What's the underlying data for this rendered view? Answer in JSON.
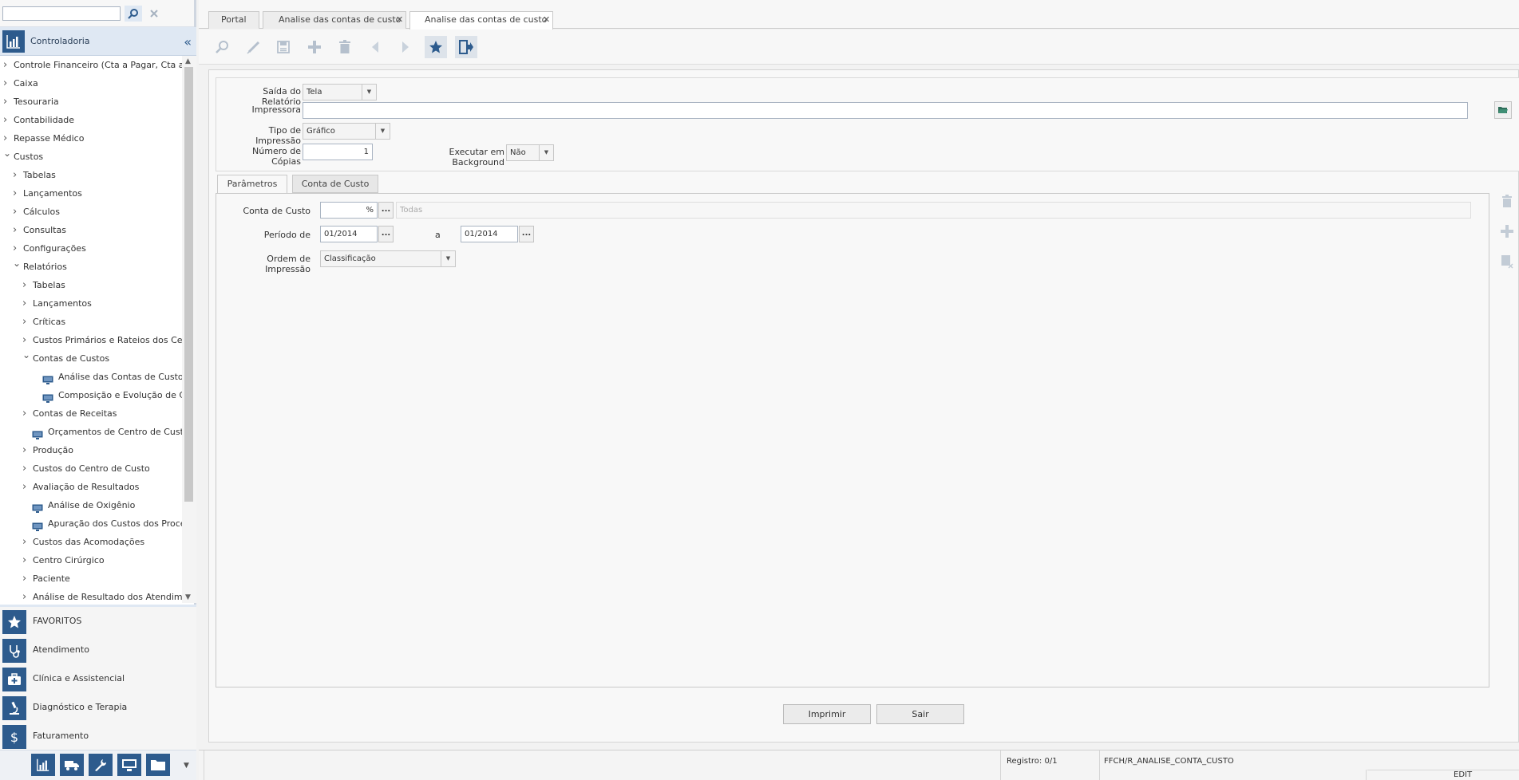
{
  "sidebar": {
    "search_placeholder": "",
    "module_title": "Controladoria",
    "tree": [
      {
        "label": "Controle Financeiro (Cta a Pagar, Cta a Rec",
        "level": 0,
        "kind": "collapsed"
      },
      {
        "label": "Caixa",
        "level": 0,
        "kind": "collapsed"
      },
      {
        "label": "Tesouraria",
        "level": 0,
        "kind": "collapsed"
      },
      {
        "label": "Contabilidade",
        "level": 0,
        "kind": "collapsed"
      },
      {
        "label": "Repasse Médico",
        "level": 0,
        "kind": "collapsed"
      },
      {
        "label": "Custos",
        "level": 0,
        "kind": "expanded"
      },
      {
        "label": "Tabelas",
        "level": 1,
        "kind": "collapsed"
      },
      {
        "label": "Lançamentos",
        "level": 1,
        "kind": "collapsed"
      },
      {
        "label": "Cálculos",
        "level": 1,
        "kind": "collapsed"
      },
      {
        "label": "Consultas",
        "level": 1,
        "kind": "collapsed"
      },
      {
        "label": "Configurações",
        "level": 1,
        "kind": "collapsed"
      },
      {
        "label": "Relatórios",
        "level": 1,
        "kind": "expanded"
      },
      {
        "label": "Tabelas",
        "level": 2,
        "kind": "collapsed"
      },
      {
        "label": "Lançamentos",
        "level": 2,
        "kind": "collapsed"
      },
      {
        "label": "Críticas",
        "level": 2,
        "kind": "collapsed"
      },
      {
        "label": "Custos Primários e Rateios dos Centro",
        "level": 2,
        "kind": "collapsed"
      },
      {
        "label": "Contas de Custos",
        "level": 2,
        "kind": "expanded"
      },
      {
        "label": "Análise das Contas de Custo",
        "level": 3,
        "kind": "screen"
      },
      {
        "label": "Composição e Evolução de Cust",
        "level": 3,
        "kind": "screen"
      },
      {
        "label": "Contas de Receitas",
        "level": 2,
        "kind": "collapsed"
      },
      {
        "label": "Orçamentos de Centro de Custo",
        "level": 2,
        "kind": "screen"
      },
      {
        "label": "Produção",
        "level": 2,
        "kind": "collapsed"
      },
      {
        "label": "Custos do Centro de Custo",
        "level": 2,
        "kind": "collapsed"
      },
      {
        "label": "Avaliação de Resultados",
        "level": 2,
        "kind": "collapsed"
      },
      {
        "label": "Análise de Oxigênio",
        "level": 2,
        "kind": "screen"
      },
      {
        "label": "Apuração dos Custos dos Procedir",
        "level": 2,
        "kind": "screen"
      },
      {
        "label": "Custos das Acomodações",
        "level": 2,
        "kind": "collapsed"
      },
      {
        "label": "Centro Cirúrgico",
        "level": 2,
        "kind": "collapsed"
      },
      {
        "label": "Paciente",
        "level": 2,
        "kind": "collapsed"
      },
      {
        "label": "Análise de Resultado dos Atendimento",
        "level": 2,
        "kind": "collapsed"
      }
    ],
    "favorites": [
      {
        "label": "FAVORITOS",
        "icon": "star-icon"
      },
      {
        "label": "Atendimento",
        "icon": "stethoscope-icon"
      },
      {
        "label": "Clínica e Assistencial",
        "icon": "medical-kit-icon"
      },
      {
        "label": "Diagnóstico e Terapia",
        "icon": "microscope-icon"
      },
      {
        "label": "Faturamento",
        "icon": "dollar-icon"
      }
    ],
    "bottom_icons": [
      "chart-icon",
      "truck-icon",
      "wrench-icon",
      "monitor-icon",
      "folder-icon"
    ]
  },
  "tabs": [
    {
      "label": "Portal",
      "closable": false,
      "active": false
    },
    {
      "label": "Analise das contas de custo",
      "closable": true,
      "active": false
    },
    {
      "label": "Analise das contas de custo",
      "closable": true,
      "active": true
    }
  ],
  "toolbar": [
    "search-icon",
    "edit-icon",
    "save-icon",
    "add-icon",
    "delete-icon",
    "previous-icon",
    "next-icon",
    "favorite-star-icon",
    "exit-icon"
  ],
  "form": {
    "saida_label": "Saída do Relatório",
    "saida_value": "Tela",
    "impressora_label": "Impressora",
    "impressora_value": "",
    "tipo_label": "Tipo de Impressão",
    "tipo_value": "Gráfico",
    "copias_label": "Número de Cópias",
    "copias_value": "1",
    "background_label": "Executar em Background",
    "background_value": "Não"
  },
  "inner_tabs": [
    "Parâmetros",
    "Conta de Custo"
  ],
  "params": {
    "conta_label": "Conta de Custo",
    "conta_value": "%",
    "conta_desc_placeholder": "Todas",
    "periodo_label": "Período de",
    "periodo_from": "01/2014",
    "periodo_sep": "a",
    "periodo_to": "01/2014",
    "ordem_label": "Ordem de Impressão",
    "ordem_value": "Classificação",
    "ellipsis": "..."
  },
  "actions": {
    "print_label": "Imprimir",
    "exit_label": "Sair"
  },
  "status": {
    "registro": "Registro: 0/1",
    "screen_code": "FFCH/R_ANALISE_CONTA_CUSTO",
    "mode": "EDIT"
  },
  "colors": {
    "accent": "#2d5b8d",
    "header_bg": "#dfe8f3"
  }
}
